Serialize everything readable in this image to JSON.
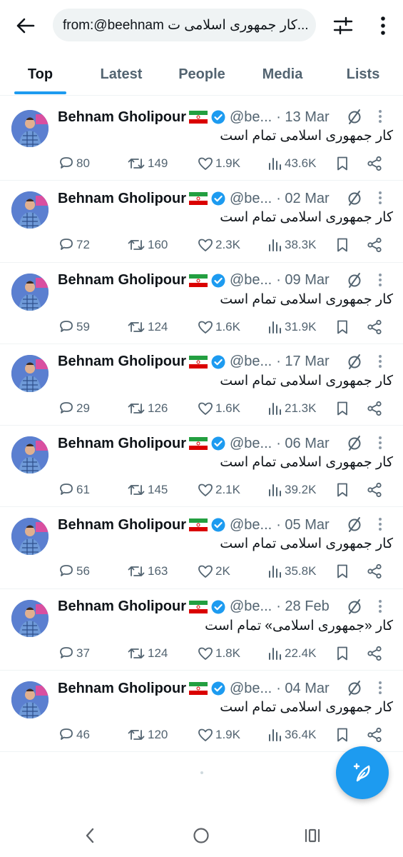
{
  "search": {
    "query": "from:@beehnam كار جمهوری اسلامی ت..."
  },
  "tabs": [
    {
      "label": "Top",
      "active": true
    },
    {
      "label": "Latest",
      "active": false
    },
    {
      "label": "People",
      "active": false
    },
    {
      "label": "Media",
      "active": false
    },
    {
      "label": "Lists",
      "active": false
    }
  ],
  "accent_color": "#1d9bf0",
  "tweets": [
    {
      "name": "Behnam Gholipour",
      "flag": "🇮🇷",
      "handle": "@be...",
      "date": "· 13 Mar",
      "text": "کار جمهوری اسلامی تمام است",
      "replies": "80",
      "retweets": "149",
      "likes": "1.9K",
      "views": "43.6K"
    },
    {
      "name": "Behnam Gholipour",
      "flag": "🇮🇷",
      "handle": "@be...",
      "date": "· 02 Mar",
      "text": "کار جمهوری اسلامی تمام است",
      "replies": "72",
      "retweets": "160",
      "likes": "2.3K",
      "views": "38.3K"
    },
    {
      "name": "Behnam Gholipour",
      "flag": "🇮🇷",
      "handle": "@be...",
      "date": "· 09 Mar",
      "text": "کار جمهوری اسلامی تمام است",
      "replies": "59",
      "retweets": "124",
      "likes": "1.6K",
      "views": "31.9K"
    },
    {
      "name": "Behnam Gholipour",
      "flag": "🇮🇷",
      "handle": "@be...",
      "date": "· 17 Mar",
      "text": "کار جمهوری اسلامی تمام است",
      "replies": "29",
      "retweets": "126",
      "likes": "1.6K",
      "views": "21.3K"
    },
    {
      "name": "Behnam Gholipour",
      "flag": "🇮🇷",
      "handle": "@be...",
      "date": "· 06 Mar",
      "text": "کار جمهوری اسلامی تمام است",
      "replies": "61",
      "retweets": "145",
      "likes": "2.1K",
      "views": "39.2K"
    },
    {
      "name": "Behnam Gholipour",
      "flag": "🇮🇷",
      "handle": "@be...",
      "date": "· 05 Mar",
      "text": "کار جمهوری اسلامی تمام است",
      "replies": "56",
      "retweets": "163",
      "likes": "2K",
      "views": "35.8K"
    },
    {
      "name": "Behnam Gholipour",
      "flag": "🇮🇷",
      "handle": "@be...",
      "date": "· 28 Feb",
      "text": "کار «جمهوری اسلامی» تمام است",
      "replies": "37",
      "retweets": "124",
      "likes": "1.8K",
      "views": "22.4K"
    },
    {
      "name": "Behnam Gholipour",
      "flag": "🇮🇷",
      "handle": "@be...",
      "date": "· 04 Mar",
      "text": "کار جمهوری اسلامی تمام است",
      "replies": "46",
      "retweets": "120",
      "likes": "1.9K",
      "views": "36.4K"
    }
  ],
  "icons": {
    "back": "back-arrow-icon",
    "filter": "sliders-icon",
    "more": "more-vertical-icon",
    "verified": "verified-badge-icon",
    "mute": "muted-icon",
    "caret": "more-vertical-icon",
    "reply": "reply-icon",
    "retweet": "retweet-icon",
    "like": "heart-icon",
    "views": "views-icon",
    "bookmark": "bookmark-icon",
    "share": "share-icon",
    "compose": "compose-icon"
  }
}
